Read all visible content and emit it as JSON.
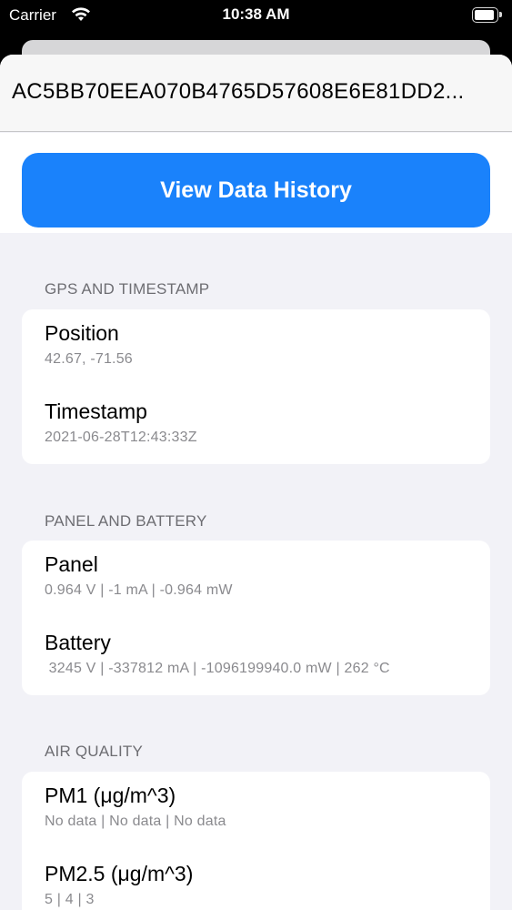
{
  "status_bar": {
    "carrier": "Carrier",
    "time": "10:38 AM",
    "battery_level": 0.9
  },
  "sheet": {
    "device_id": "AC5BB70EEA070B4765D57608E6E81DD2..."
  },
  "history_button": {
    "label": "View Data History"
  },
  "sections": {
    "gps": {
      "header": "GPS AND TIMESTAMP",
      "position": {
        "title": "Position",
        "value": "42.67, -71.56"
      },
      "timestamp": {
        "title": "Timestamp",
        "value": "2021-06-28T12:43:33Z"
      }
    },
    "power": {
      "header": "PANEL AND BATTERY",
      "panel": {
        "title": "Panel",
        "value": "0.964 V | -1 mA | -0.964 mW"
      },
      "battery": {
        "title": "Battery",
        "value": " 3245 V | -337812 mA | -1096199940.0 mW | 262 °C"
      }
    },
    "air": {
      "header": "AIR QUALITY",
      "pm1": {
        "title": "PM1 (μg/m^3)",
        "value": "No data | No data | No data"
      },
      "pm25": {
        "title": "PM2.5 (μg/m^3)",
        "value": "5 | 4 | 3"
      }
    }
  },
  "colors": {
    "accent": "#1a82fb",
    "background": "#f2f2f7",
    "secondary_text": "#8a8a8e"
  }
}
